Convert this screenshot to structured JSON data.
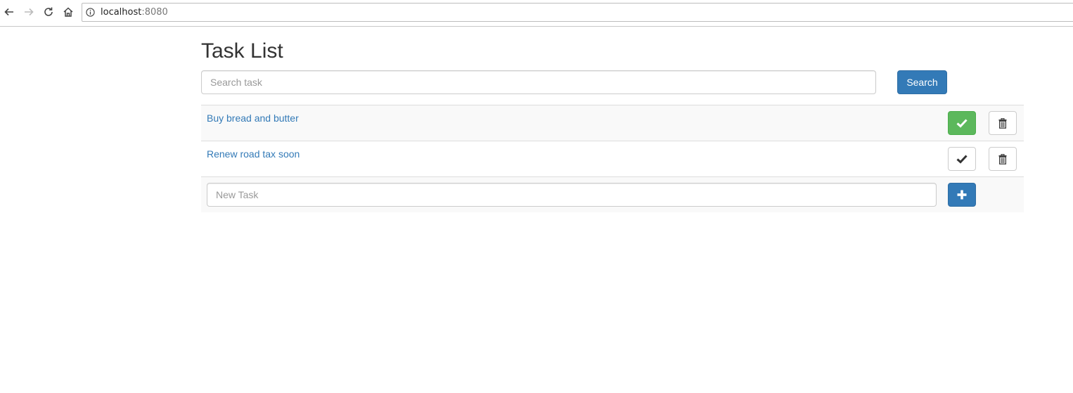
{
  "browser": {
    "url_host": "localhost",
    "url_port": ":8080",
    "icons": {
      "back": "back-arrow-icon",
      "forward": "forward-arrow-icon",
      "reload": "reload-icon",
      "home": "home-icon",
      "info": "info-icon"
    }
  },
  "page": {
    "title": "Task List",
    "search": {
      "placeholder": "Search task",
      "value": ""
    },
    "search_button_label": "Search",
    "tasks": [
      {
        "label": "Buy bread and butter",
        "done": true
      },
      {
        "label": "Renew road tax soon",
        "done": false
      }
    ],
    "new_task": {
      "placeholder": "New Task",
      "value": ""
    }
  },
  "colors": {
    "primary": "#337ab7",
    "success": "#5cb85c",
    "link": "#337ab7",
    "stripe": "#f9f9f9"
  }
}
